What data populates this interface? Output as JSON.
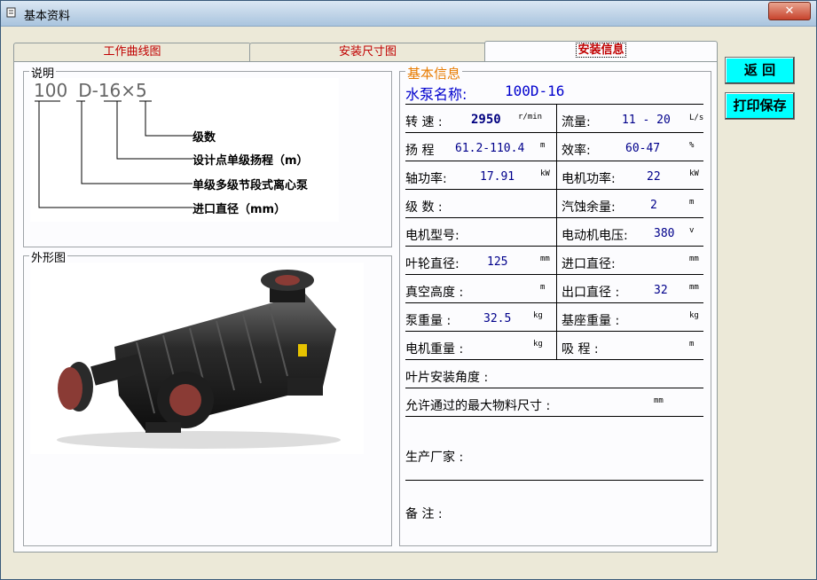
{
  "window": {
    "title": "基本资料",
    "close_label": "✕"
  },
  "tabs": [
    {
      "label": "工作曲线图"
    },
    {
      "label": "安装尺寸图"
    },
    {
      "label": "安装信息"
    }
  ],
  "buttons": {
    "back": "返  回",
    "print": "打印保存"
  },
  "explain": {
    "legend": "说明",
    "model_code": {
      "p1": "100",
      "p2": "D",
      "p3": "-",
      "p4": "16",
      "p5": "×",
      "p6": "5"
    },
    "items": [
      "级数",
      "设计点单级扬程（m）",
      "单级多级节段式离心泵",
      "进口直径（mm）"
    ]
  },
  "outline": {
    "legend": "外形图"
  },
  "info": {
    "legend": "基本信息",
    "pump_name_label": "水泵名称:",
    "pump_name": "100D-16",
    "speed_label": "转 速 :",
    "speed": "2950",
    "speed_unit": "r/min",
    "flow_label": "流量:",
    "flow": "11 - 20",
    "flow_unit": "L/s",
    "head_label": "扬 程",
    "head": "61.2-110.4",
    "head_unit": "m",
    "eff_label": "效率:",
    "eff": "60-47",
    "eff_unit": "%",
    "shaft_power_label": "轴功率:",
    "shaft_power": "17.91",
    "shaft_power_unit": "kW",
    "motor_power_label": "电机功率:",
    "motor_power": "22",
    "motor_power_unit": "kW",
    "stages_label": "级 数 :",
    "npsh_label": "汽蚀余量:",
    "npsh": "2",
    "npsh_unit": "m",
    "motor_model_label": "电机型号:",
    "motor_voltage_label": "电动机电压:",
    "motor_voltage": "380",
    "motor_voltage_unit": "v",
    "impeller_label": "叶轮直径:",
    "impeller": "125",
    "impeller_unit": "mm",
    "inlet_label": "进口直径:",
    "inlet_unit": "mm",
    "vacuum_label": "真空高度 :",
    "vacuum_unit": "m",
    "outlet_label": "出口直径 :",
    "outlet": "32",
    "outlet_unit": "mm",
    "pump_weight_label": "泵重量 :",
    "pump_weight": "32.5",
    "pump_weight_unit": "kg",
    "base_weight_label": "基座重量 :",
    "base_weight_unit": "kg",
    "motor_weight_label": "电机重量 :",
    "motor_weight_unit": "kg",
    "suction_label": "吸 程 :",
    "suction_unit": "m",
    "blade_angle_label": "叶片安装角度 :",
    "max_particle_label": "允许通过的最大物料尺寸 :",
    "max_particle_unit": "mm",
    "manufacturer_label": "生产厂家 :",
    "remarks_label": "备  注 :"
  },
  "colors": {
    "tab_text": "#c00000",
    "value_text": "#00008b",
    "legend_orange": "#e87b00",
    "button_cyan": "#00ffff"
  }
}
